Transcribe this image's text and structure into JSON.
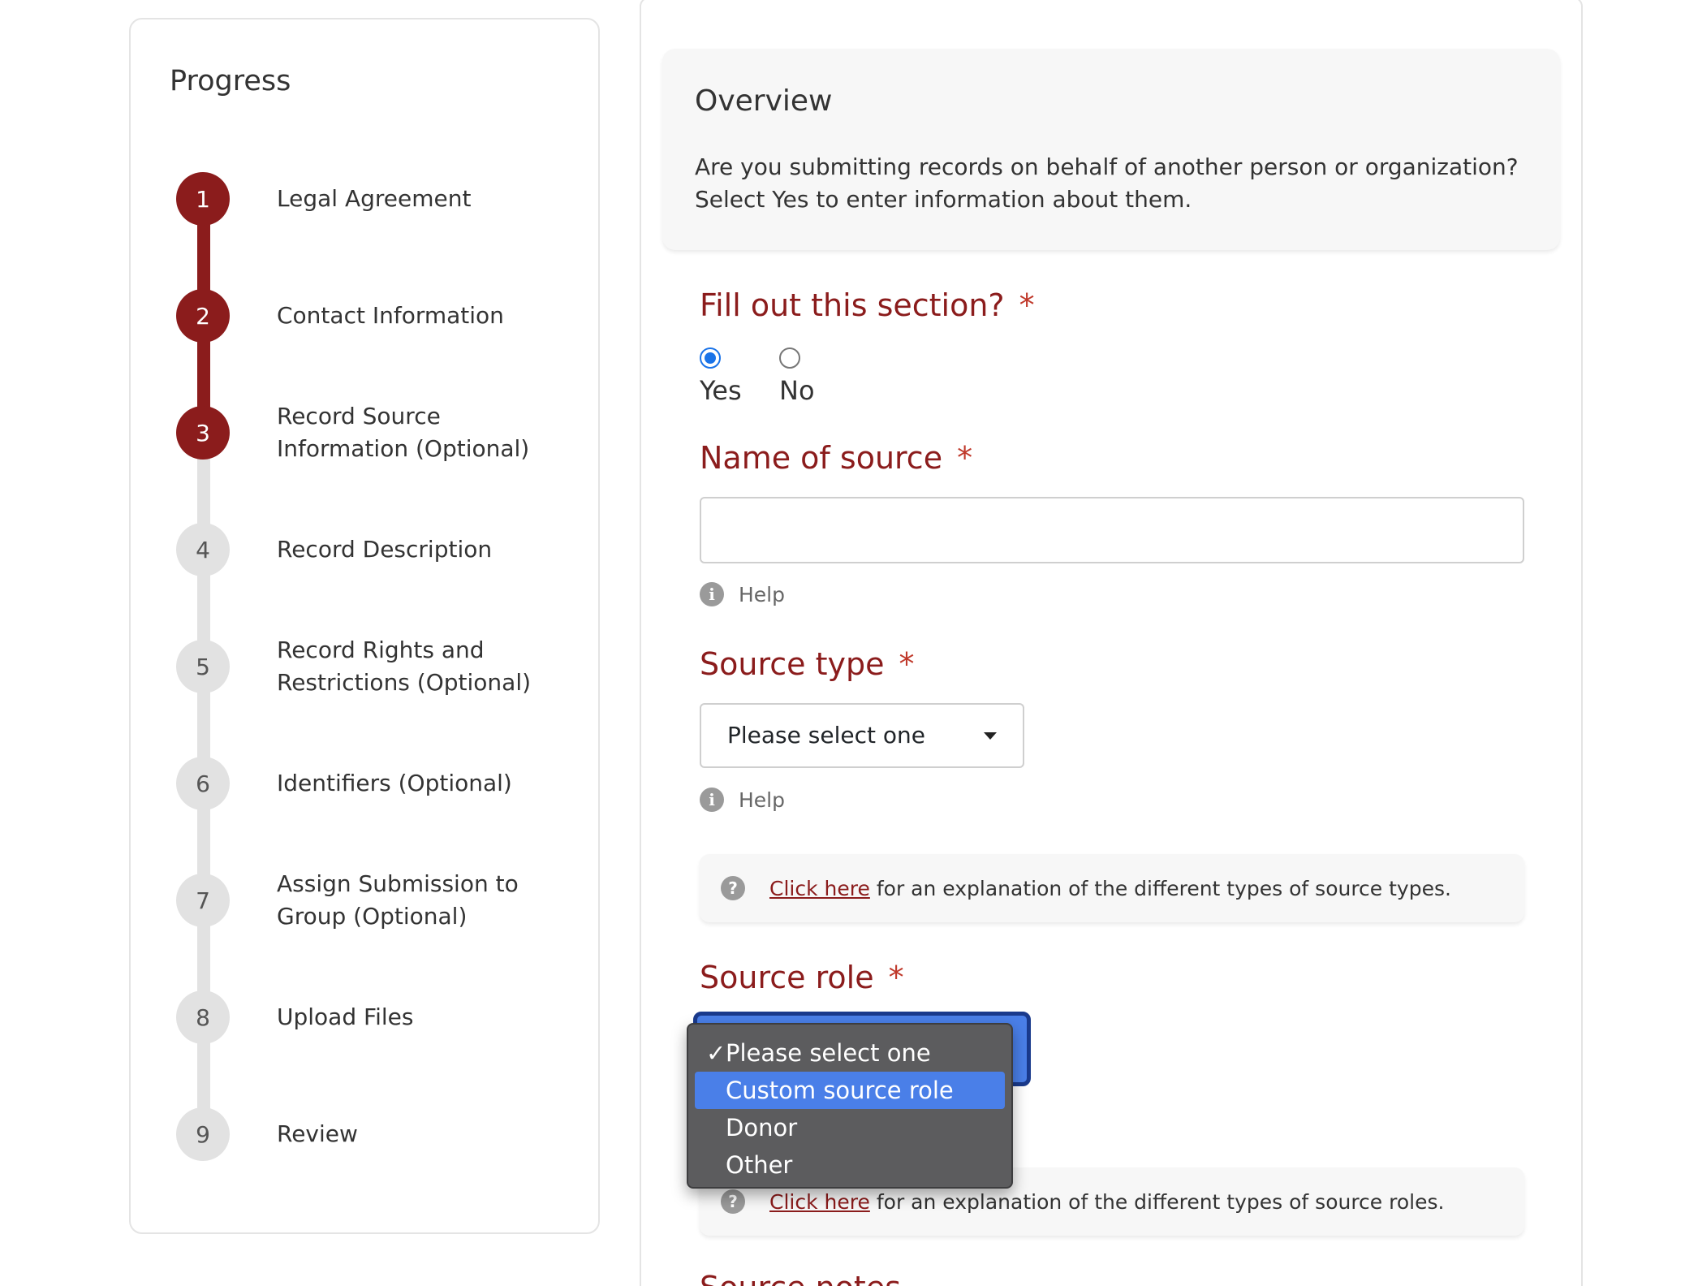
{
  "progress": {
    "title": "Progress",
    "steps": [
      {
        "number": "1",
        "label": "Legal Agreement",
        "status": "complete"
      },
      {
        "number": "2",
        "label": "Contact Information",
        "status": "complete"
      },
      {
        "number": "3",
        "label": "Record Source Information (Optional)",
        "status": "current"
      },
      {
        "number": "4",
        "label": "Record Description",
        "status": "pending"
      },
      {
        "number": "5",
        "label": "Record Rights and Restrictions (Optional)",
        "status": "pending"
      },
      {
        "number": "6",
        "label": "Identifiers (Optional)",
        "status": "pending"
      },
      {
        "number": "7",
        "label": "Assign Submission to Group (Optional)",
        "status": "pending"
      },
      {
        "number": "8",
        "label": "Upload Files",
        "status": "pending"
      },
      {
        "number": "9",
        "label": "Review",
        "status": "pending"
      }
    ]
  },
  "overview": {
    "title": "Overview",
    "text": "Are you submitting records on behalf of another person or organization? Select Yes to enter information about them."
  },
  "fill_section": {
    "label": "Fill out this section?",
    "required_mark": "*",
    "options": [
      {
        "label": "Yes",
        "checked": true
      },
      {
        "label": "No",
        "checked": false
      }
    ]
  },
  "name_of_source": {
    "label": "Name of source",
    "required_mark": "*",
    "value": "",
    "help_label": "Help"
  },
  "source_type": {
    "label": "Source type",
    "required_mark": "*",
    "selected": "Please select one",
    "help_label": "Help",
    "explain_link": "Click here",
    "explain_text": "for an explanation of the different types of source types."
  },
  "source_role": {
    "label": "Source role",
    "required_mark": "*",
    "dropdown_options": [
      {
        "label": "Please select one",
        "checked": true,
        "highlighted": false
      },
      {
        "label": "Custom source role",
        "checked": false,
        "highlighted": true
      },
      {
        "label": "Donor",
        "checked": false,
        "highlighted": false
      },
      {
        "label": "Other",
        "checked": false,
        "highlighted": false
      }
    ],
    "check_glyph": "✓",
    "explain_link": "Click here",
    "explain_text": "for an explanation of the different types of source roles."
  },
  "source_notes": {
    "label": "Source notes"
  },
  "colors": {
    "accent": "#8b1c1c",
    "radio_blue": "#1a73e8",
    "dropdown_bg": "#5c5c5e",
    "dropdown_highlight": "#4a7fe8"
  }
}
